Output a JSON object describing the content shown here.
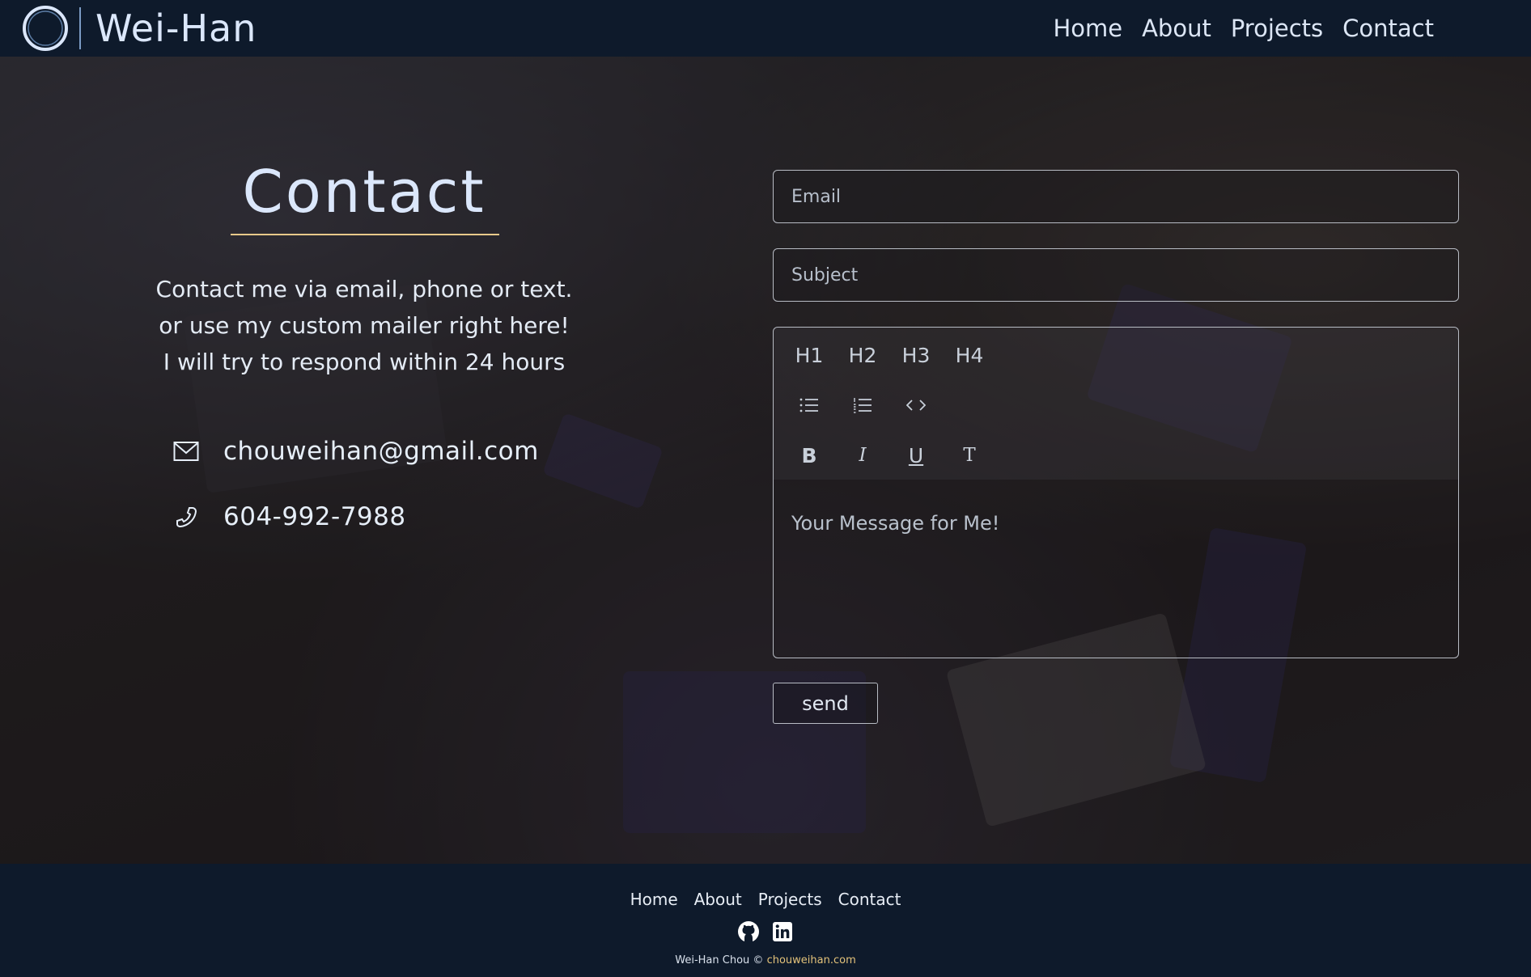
{
  "brand": {
    "name": "Wei-Han"
  },
  "nav": {
    "items": [
      "Home",
      "About",
      "Projects",
      "Contact"
    ]
  },
  "contact": {
    "title": "Contact",
    "intro": [
      "Contact me via email, phone or text.",
      "or use my custom mailer right here!",
      "I will try to respond within 24 hours"
    ],
    "email": "chouweihan@gmail.com",
    "phone": "604-992-7988"
  },
  "form": {
    "email_placeholder": "Email",
    "subject_placeholder": "Subject",
    "message_placeholder": "Your Message for Me!",
    "send_label": "send",
    "toolbar": {
      "headings": [
        "H1",
        "H2",
        "H3",
        "H4"
      ],
      "formats": [
        "B",
        "I",
        "U",
        "T"
      ]
    }
  },
  "footer": {
    "nav": [
      "Home",
      "About",
      "Projects",
      "Contact"
    ],
    "copyright_name": "Wei-Han Chou ©",
    "copyright_site": "chouweihan.com"
  },
  "colors": {
    "header_bg": "#0e1a2b",
    "accent_underline": "#e8c98a",
    "brand_text": "#dbe7fb"
  },
  "icons": [
    "logo-ring-icon",
    "mail-icon",
    "phone-icon",
    "bullet-list-icon",
    "numbered-list-icon",
    "code-icon",
    "github-icon",
    "linkedin-icon"
  ]
}
